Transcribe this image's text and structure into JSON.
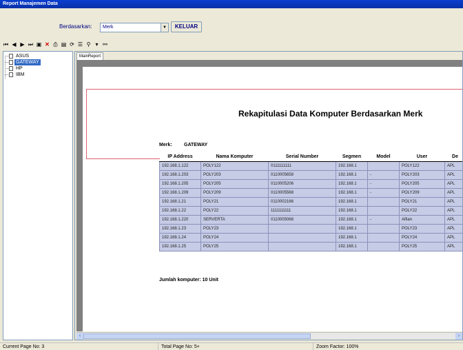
{
  "window": {
    "title": "Report Manajemen Data"
  },
  "filter": {
    "label": "Berdasarkan:",
    "value": "Merk",
    "exit_label": "KELUAR"
  },
  "toolbar": {
    "icons": [
      "first-page",
      "prev-page",
      "next-page",
      "last-page",
      "export",
      "close",
      "print",
      "print-setup",
      "refresh",
      "group-tree",
      "zoom",
      "search"
    ]
  },
  "tree": {
    "items": [
      {
        "label": "ASUS",
        "selected": false
      },
      {
        "label": "GATEWAY",
        "selected": true
      },
      {
        "label": "HP",
        "selected": false
      },
      {
        "label": "IBM",
        "selected": false
      }
    ]
  },
  "report": {
    "tab_label": "MainReport",
    "title": "Rekapitulasi Data Komputer Berdasarkan Merk",
    "merk_label": "Merk:",
    "merk_value": "GATEWAY",
    "columns": [
      "IP Address",
      "Nama Komputer",
      "Serial Number",
      "Segmen",
      "Model",
      "User",
      "De"
    ],
    "rows": [
      [
        "192.168.1.122",
        "POLY122",
        "0111111111",
        "192.168.1",
        "",
        "POLY122",
        "APL"
      ],
      [
        "192.168.1.203",
        "POLY203",
        "0110005658",
        "192.168.1",
        "-",
        "POLY203",
        "APL"
      ],
      [
        "192.168.1.205",
        "POLY205",
        "0110005206",
        "192.168.1",
        "-",
        "POLY205",
        "APL"
      ],
      [
        "192.168.1.209",
        "POLY209",
        "0110005568",
        "192.168.1",
        "-",
        "POLY209",
        "APL"
      ],
      [
        "192.168.1.21",
        "POLY21",
        "0110002166",
        "192.168.1",
        "",
        "POLY21",
        "APL"
      ],
      [
        "192.168.1.22",
        "POLY22",
        "1111111111",
        "192.168.1",
        "",
        "POLY22",
        "APL"
      ],
      [
        "192.168.1.220",
        "SERVERTA",
        "0110005068",
        "192.168.1",
        "-",
        "Alfian",
        "APL"
      ],
      [
        "192.168.1.23",
        "POLY23",
        "",
        "192.168.1",
        "",
        "POLY23",
        "APL"
      ],
      [
        "192.168.1.24",
        "POLY24",
        "",
        "192.168.1",
        "",
        "POLY24",
        "APL"
      ],
      [
        "192.168.1.25",
        "POLY25",
        "",
        "192.168.1",
        "",
        "POLY25",
        "APL"
      ]
    ],
    "total_label": "Jumlah komputer:",
    "total_value": "10 Unit"
  },
  "status": {
    "current_page": "Current Page No: 3",
    "total_page": "Total Page No: 5+",
    "zoom": "Zoom Factor: 100%"
  }
}
